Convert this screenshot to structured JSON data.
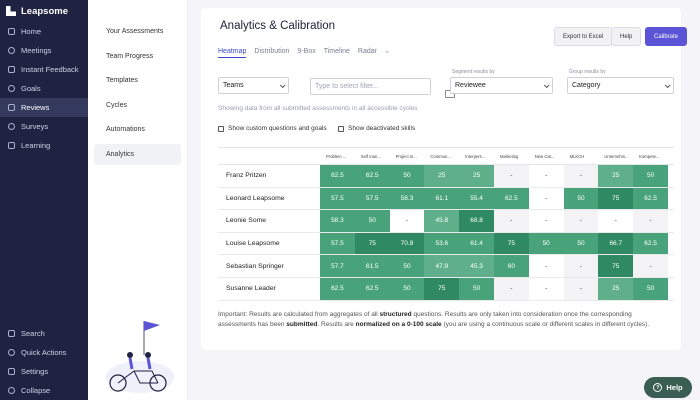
{
  "nav": {
    "brand": "Leapsome",
    "items": [
      {
        "label": "Home",
        "icon": "home-icon"
      },
      {
        "label": "Meetings",
        "icon": "meetings-icon"
      },
      {
        "label": "Instant Feedback",
        "icon": "feedback-icon"
      },
      {
        "label": "Goals",
        "icon": "goals-icon"
      },
      {
        "label": "Reviews",
        "icon": "reviews-icon"
      },
      {
        "label": "Surveys",
        "icon": "surveys-icon"
      },
      {
        "label": "Learning",
        "icon": "learning-icon"
      }
    ],
    "bottom": [
      {
        "label": "Search",
        "icon": "search-icon"
      },
      {
        "label": "Quick Actions",
        "icon": "quick-actions-icon"
      },
      {
        "label": "Settings",
        "icon": "settings-icon"
      },
      {
        "label": "Collapse",
        "icon": "collapse-icon"
      }
    ]
  },
  "subnav": {
    "items": [
      "Your Assessments",
      "Team Progress",
      "Templates",
      "Cycles",
      "Automations",
      "Analytics"
    ]
  },
  "page": {
    "title": "Analytics & Calibration",
    "tabs": [
      "Heatmap",
      "Distribution",
      "9-Box",
      "Timeline",
      "Radar"
    ],
    "export_label": "Export to Excel",
    "help_label": "Help",
    "calibrate_label": "Calibrate"
  },
  "filters": {
    "team_select": "Teams",
    "filter_placeholder": "Type to select filter...",
    "segment_label": "Segment results by",
    "segment_value": "Reviewee",
    "group_label": "Group results by",
    "group_value": "Category",
    "hint": "Showing data from all submitted assessments in all accessible cycles",
    "checkbox1": "Show custom questions and goals",
    "checkbox2": "Show deactivated skills"
  },
  "heatmap": {
    "columns": [
      "Problem ...",
      "Self man...",
      "Project m...",
      "Commun...",
      "Interpers...",
      "Marketing",
      "New Cat...",
      "MLKCH",
      "Unternehm...",
      "Kompete..."
    ],
    "rows": [
      {
        "name": "Franz Pritzen",
        "values": [
          "62.5",
          "62.5",
          "50",
          "25",
          "25",
          "-",
          "-",
          "-",
          "25",
          "50"
        ]
      },
      {
        "name": "Leonard Leapsome",
        "values": [
          "57.5",
          "57.5",
          "58.3",
          "61.1",
          "55.4",
          "62.5",
          "-",
          "50",
          "75",
          "62.5"
        ]
      },
      {
        "name": "Leonie Some",
        "values": [
          "58.3",
          "50",
          "-",
          "45.8",
          "68.8",
          "-",
          "-",
          "-",
          "-",
          "-"
        ]
      },
      {
        "name": "Louise Leapsome",
        "values": [
          "57.5",
          "75",
          "70.8",
          "53.6",
          "61.4",
          "75",
          "50",
          "50",
          "66.7",
          "62.5"
        ]
      },
      {
        "name": "Sebastian Springer",
        "values": [
          "57.7",
          "61.5",
          "50",
          "47.9",
          "45.3",
          "60",
          "-",
          "-",
          "75",
          "-"
        ]
      },
      {
        "name": "Susanne Leader",
        "values": [
          "62.5",
          "62.5",
          "50",
          "75",
          "50",
          "-",
          "-",
          "-",
          "25",
          "50"
        ]
      }
    ],
    "colors": {
      "high": "#2f8a63",
      "mid": "#48a37a",
      "low": "#5fb08a",
      "empty": "#ffffff",
      "col_tint_a": "#f3f3f6"
    }
  },
  "note": {
    "part1": "Important: Results are calculated from aggregates of all ",
    "bold1": "structured",
    "part2": " questions. Results are only taken into consideration once the corresponding assessments has been ",
    "bold2": "submitted",
    "part3": ". Results are ",
    "bold3": "normalized on a 0-100 scale",
    "part4": " (you are using a continuous scale or different scales in different cycles)."
  },
  "help_fab": "Help"
}
